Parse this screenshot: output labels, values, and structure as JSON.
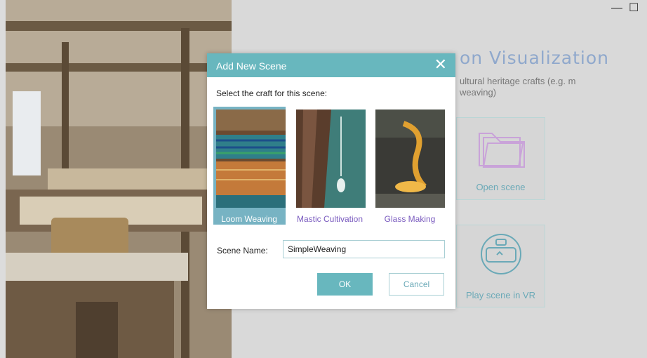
{
  "background": {
    "title": "MoVi - Craft Visualization",
    "title_visible": "on Visualization",
    "description": "ultural heritage crafts (e.g. m weaving)",
    "cards": [
      {
        "label": "Open scene",
        "icon": "folder-icon"
      },
      {
        "label": "Play scene in VR",
        "icon": "vr-headset-icon"
      }
    ]
  },
  "window_controls": {
    "minimize": "—",
    "maximize": "☐"
  },
  "dialog": {
    "title": "Add New Scene",
    "close_glyph": "✕",
    "prompt": "Select the craft for this scene:",
    "crafts": [
      {
        "label": "Loom Weaving",
        "selected": true
      },
      {
        "label": "Mastic Cultivation",
        "selected": false
      },
      {
        "label": "Glass Making",
        "selected": false
      }
    ],
    "scene_name_label": "Scene Name:",
    "scene_name_value": "SimpleWeaving",
    "ok_label": "OK",
    "cancel_label": "Cancel"
  },
  "colors": {
    "accent": "#68b7be",
    "selected_bg": "#77b3c3",
    "craft_label": "#7a5bbf"
  }
}
